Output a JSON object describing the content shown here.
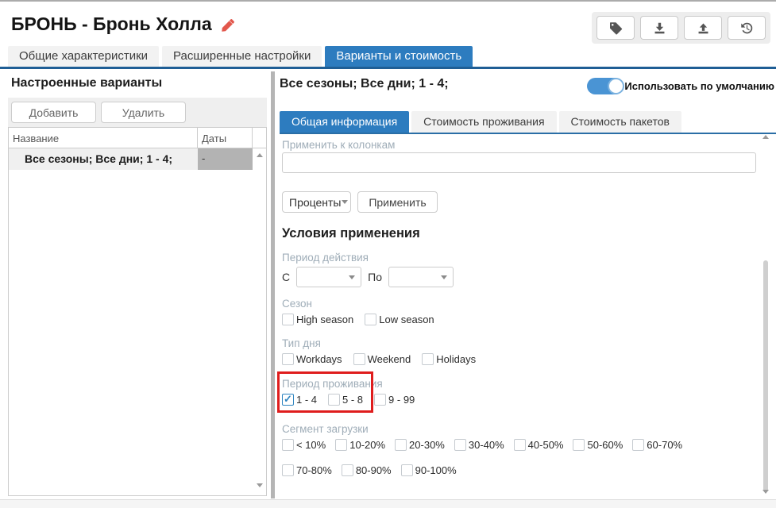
{
  "header": {
    "title": "БРОНЬ - Бронь Холла",
    "edit_icon": "pencil-icon",
    "toolbar_icons": [
      "tag-icon",
      "download-icon",
      "upload-icon",
      "history-icon"
    ]
  },
  "main_tabs": [
    {
      "label": "Общие характеристики",
      "active": false
    },
    {
      "label": "Расширенные настройки",
      "active": false
    },
    {
      "label": "Варианты и стоимость",
      "active": true
    }
  ],
  "left_panel": {
    "heading": "Настроенные варианты",
    "add_button": "Добавить",
    "delete_button": "Удалить",
    "table": {
      "columns": {
        "name": "Название",
        "dates": "Даты"
      },
      "rows": [
        {
          "name": "Все сезоны; Все дни; 1 - 4;",
          "dates": "-",
          "selected": true
        }
      ]
    }
  },
  "right_panel": {
    "variant_title": "Все сезоны; Все дни; 1 - 4;",
    "default_toggle": {
      "label": "Использовать по умолчанию",
      "on": true
    },
    "sub_tabs": [
      {
        "label": "Общая информация",
        "active": true
      },
      {
        "label": "Стоимость проживания",
        "active": false
      },
      {
        "label": "Стоимость пакетов",
        "active": false
      }
    ],
    "apply_to_columns": {
      "label": "Применить к колонкам",
      "value": ""
    },
    "mode_select": {
      "value": "Проценты"
    },
    "apply_button": "Применить",
    "conditions": {
      "heading": "Условия применения",
      "validity_period": {
        "label": "Период действия",
        "from_label": "С",
        "to_label": "По",
        "from_value": "",
        "to_value": ""
      },
      "season": {
        "label": "Сезон",
        "options": [
          {
            "label": "High season",
            "checked": false
          },
          {
            "label": "Low season",
            "checked": false
          }
        ]
      },
      "day_type": {
        "label": "Тип дня",
        "options": [
          {
            "label": "Workdays",
            "checked": false
          },
          {
            "label": "Weekend",
            "checked": false
          },
          {
            "label": "Holidays",
            "checked": false
          }
        ]
      },
      "stay_period": {
        "label": "Период проживания",
        "highlighted": true,
        "options": [
          {
            "label": "1 - 4",
            "checked": true
          },
          {
            "label": "5 - 8",
            "checked": false
          },
          {
            "label": "9 - 99",
            "checked": false
          }
        ]
      },
      "load_segment": {
        "label": "Сегмент загрузки",
        "rows": [
          [
            {
              "label": "< 10%",
              "checked": false
            },
            {
              "label": "10-20%",
              "checked": false
            },
            {
              "label": "20-30%",
              "checked": false
            },
            {
              "label": "30-40%",
              "checked": false
            },
            {
              "label": "40-50%",
              "checked": false
            },
            {
              "label": "50-60%",
              "checked": false
            },
            {
              "label": "60-70%",
              "checked": false
            }
          ],
          [
            {
              "label": "70-80%",
              "checked": false
            },
            {
              "label": "80-90%",
              "checked": false
            },
            {
              "label": "90-100%",
              "checked": false
            }
          ]
        ]
      }
    }
  },
  "colors": {
    "accent_blue": "#2d7cbf",
    "tab_underline": "#1f5e95",
    "toggle_blue": "#4a94d4",
    "checkbox_checked": "#2e84c0",
    "highlight_red": "#df1d1d",
    "selected_cell_gray": "#b3b3b3",
    "muted_label": "#9fadb8"
  }
}
